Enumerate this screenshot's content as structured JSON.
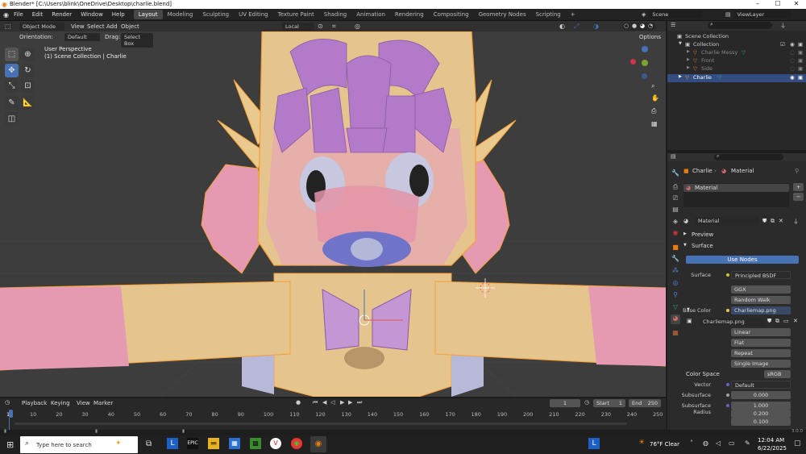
{
  "titlebar": {
    "title": "Blender* [C:\\Users\\blink\\OneDrive\\Desktop\\charlie.blend]",
    "min": "–",
    "max": "☐",
    "close": "✕"
  },
  "menu": [
    "File",
    "Edit",
    "Render",
    "Window",
    "Help"
  ],
  "workspaces": [
    "Layout",
    "Modeling",
    "Sculpting",
    "UV Editing",
    "Texture Paint",
    "Shading",
    "Animation",
    "Rendering",
    "Compositing",
    "Geometry Nodes",
    "Scripting",
    "+"
  ],
  "scene": {
    "name": "Scene",
    "view_layer": "ViewLayer"
  },
  "viewport_header": {
    "mode": "Object Mode",
    "view": "View",
    "select": "Select",
    "add": "Add",
    "object": "Object",
    "transform": "Local",
    "options": "Options"
  },
  "tool_settings": {
    "orientation_label": "Orientation:",
    "orientation": "Default",
    "drag_label": "Drag:",
    "drag": "Select Box"
  },
  "viewport_info": {
    "perspective": "User Perspective",
    "collection": "(1) Scene Collection | Charlie"
  },
  "outliner": {
    "search_placeholder": "",
    "items": [
      {
        "label": "Scene Collection"
      },
      {
        "label": "Collection"
      },
      {
        "label": "Charlie Messy"
      },
      {
        "label": "Front"
      },
      {
        "label": "Side"
      },
      {
        "label": "Charlie"
      }
    ]
  },
  "properties": {
    "breadcrumb_object": "Charlie",
    "breadcrumb_material": "Material",
    "slot": "Material",
    "material_name": "Material",
    "preview": "Preview",
    "surface_panel": "Surface",
    "use_nodes": "Use Nodes",
    "surface_label": "Surface",
    "surface_value": "Principled BSDF",
    "distribution": "GGX",
    "subsurface_method": "Random Walk",
    "base_color_label": "Base Color",
    "base_color_value": "Charliemap.png",
    "image_name": "Charliemap.png",
    "interpolation": "Linear",
    "projection": "Flat",
    "extension": "Repeat",
    "source": "Single Image",
    "color_space_label": "Color Space",
    "color_space": "sRGB",
    "vector_label": "Vector",
    "vector_value": "Default",
    "subsurface_label": "Subsurface",
    "subsurface_value": "0.000",
    "subsurface_radius_label": "Subsurface Radius",
    "radius": [
      "1.000",
      "0.200",
      "0.100"
    ]
  },
  "timeline": {
    "playback": "Playback",
    "keying": "Keying",
    "view": "View",
    "marker": "Marker",
    "current_frame": "1",
    "start_label": "Start",
    "start": "1",
    "end_label": "End",
    "end": "250",
    "ticks": [
      "1",
      "10",
      "20",
      "30",
      "40",
      "50",
      "60",
      "70",
      "80",
      "90",
      "100",
      "110",
      "120",
      "130",
      "140",
      "150",
      "160",
      "170",
      "180",
      "190",
      "200",
      "210",
      "220",
      "230",
      "240",
      "250"
    ]
  },
  "statusbar": {
    "version": "3.0.0"
  },
  "taskbar": {
    "search_placeholder": "Type here to search",
    "weather": "76°F Clear",
    "time": "12:04 AM",
    "date": "6/22/2025"
  },
  "colors": {
    "accent": "#4772b3",
    "selection_orange": "#f5a033",
    "viewport_bg": "#3d3d3d"
  }
}
